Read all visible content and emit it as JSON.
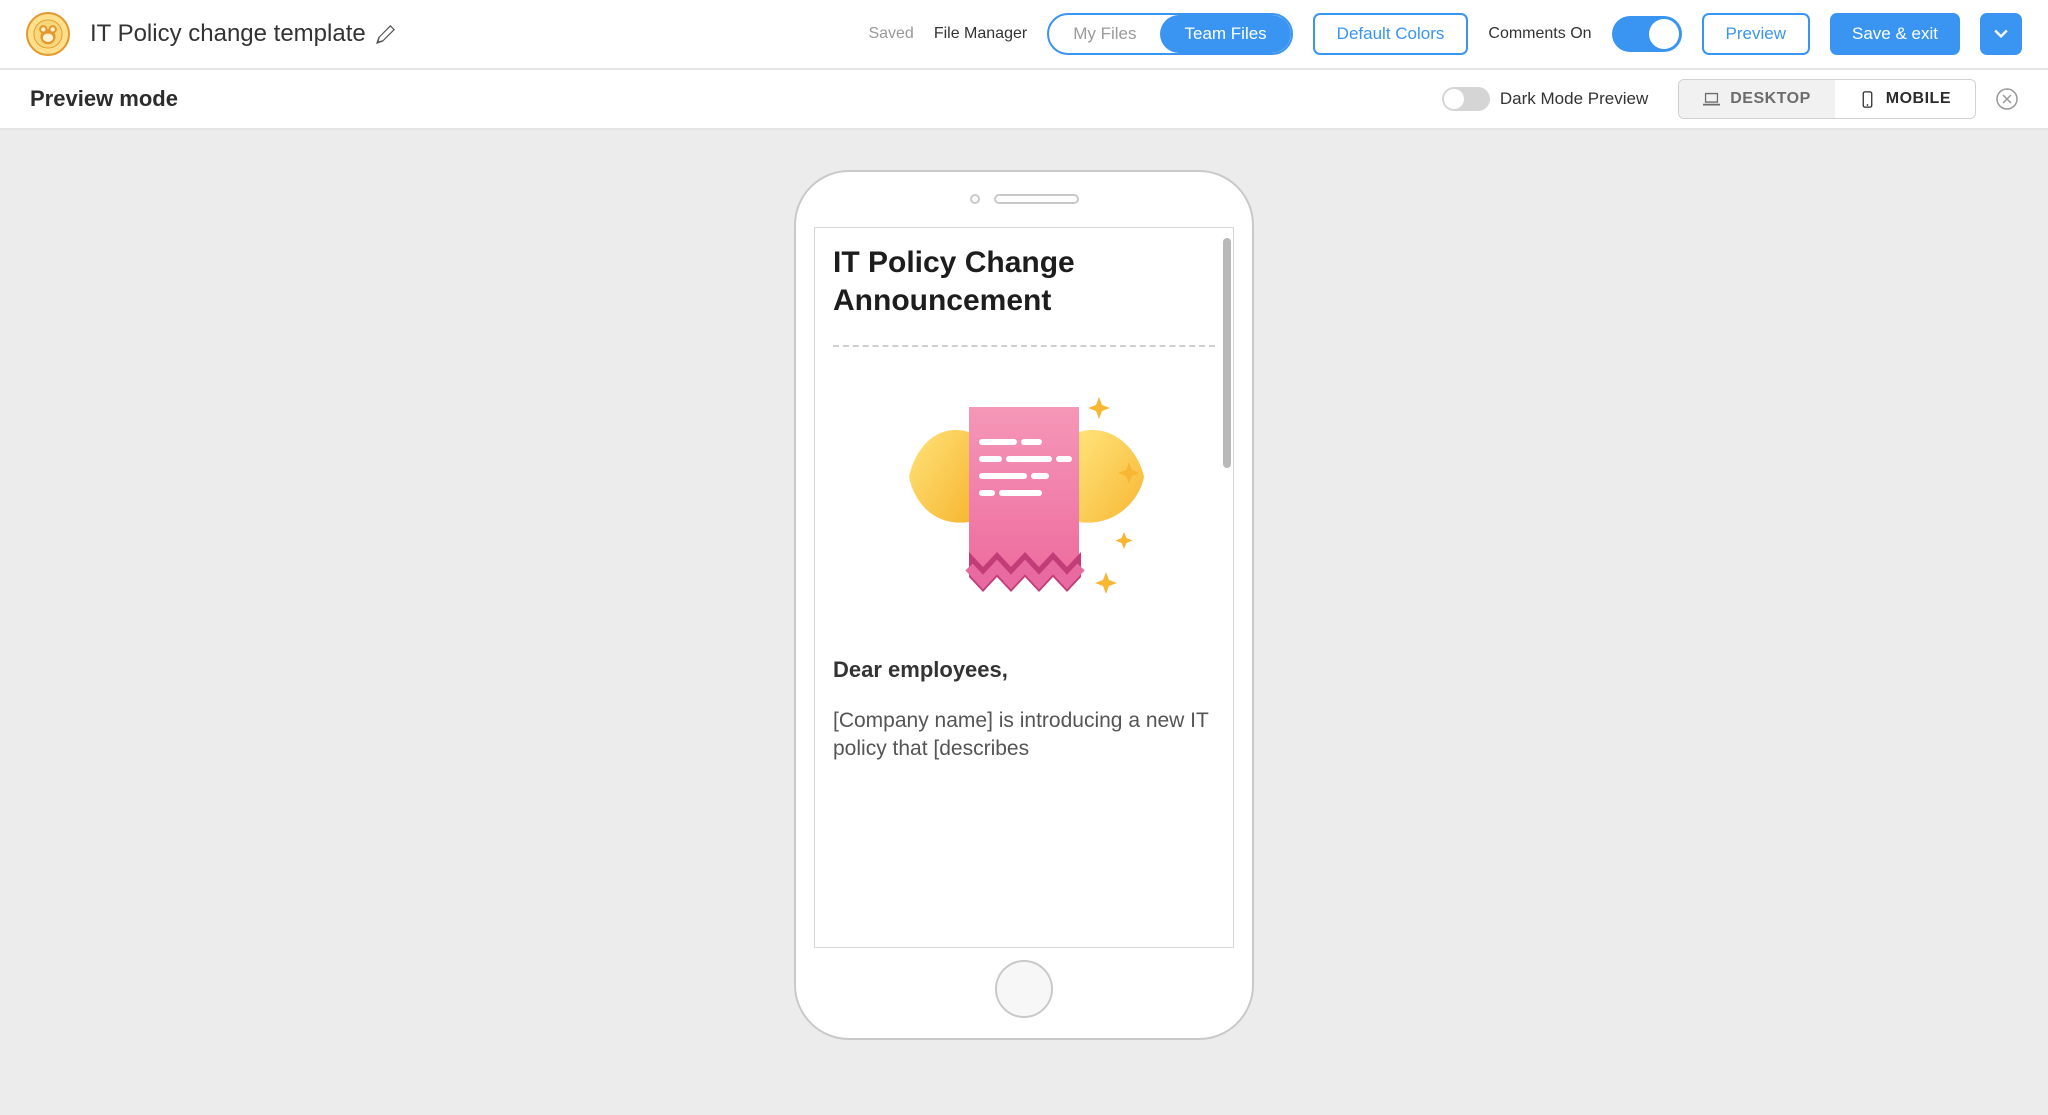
{
  "toolbar": {
    "title": "IT Policy change template",
    "saved": "Saved",
    "file_manager": "File Manager",
    "my_files": "My Files",
    "team_files": "Team Files",
    "default_colors": "Default Colors",
    "comments_on": "Comments On",
    "preview": "Preview",
    "save_exit": "Save & exit"
  },
  "subbar": {
    "title": "Preview mode",
    "dark_mode": "Dark Mode Preview",
    "desktop": "DESKTOP",
    "mobile": "MOBILE"
  },
  "email": {
    "heading": "IT Policy Change Announcement",
    "salutation": "Dear employees,",
    "body": "[Company name] is introducing a new IT policy that [describes"
  }
}
